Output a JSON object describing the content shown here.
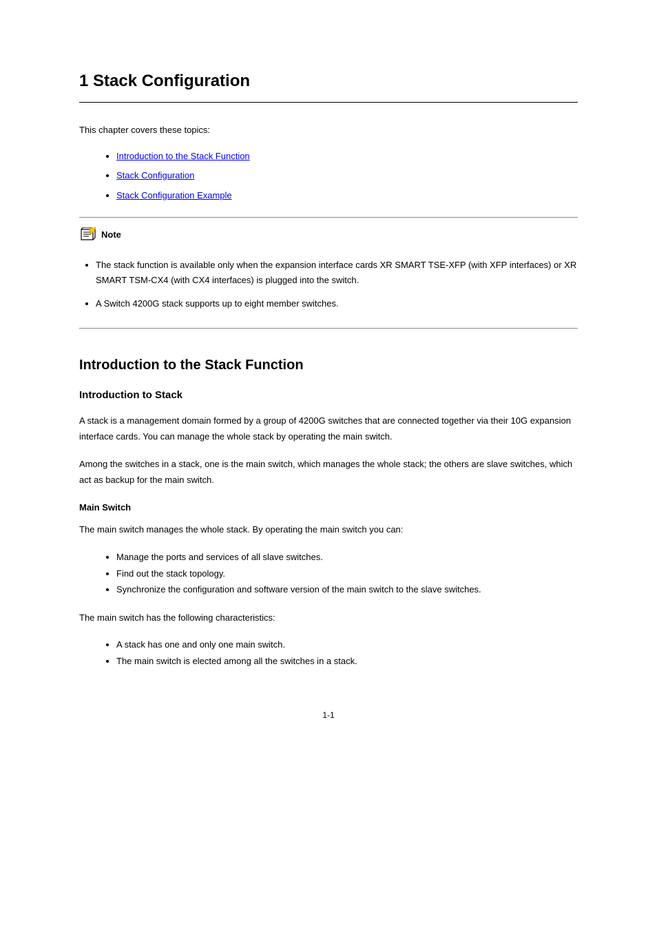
{
  "chapter_title": "1 Stack Configuration",
  "intro_text": "This chapter covers these topics:",
  "toc_links": [
    {
      "label": "Introduction to the Stack Function"
    },
    {
      "label": "Stack Configuration"
    },
    {
      "label": "Stack Configuration Example"
    }
  ],
  "note": {
    "label": "Note",
    "items": [
      "The stack function is available only when the expansion interface cards XR SMART TSE-XFP (with XFP interfaces) or XR SMART TSM-CX4 (with CX4 interfaces) is plugged into the switch.",
      "A Switch 4200G stack supports up to eight member switches."
    ]
  },
  "section1": {
    "title": "Introduction to the Stack Function",
    "sub1": {
      "title": "Introduction to Stack",
      "para1": "A stack is a management domain formed by a group of 4200G switches that are connected together via their 10G expansion interface cards. You can manage the whole stack by operating the main switch.",
      "para2": "Among the switches in a stack, one is the main switch, which manages the whole stack; the others are slave switches, which act as backup for the main switch."
    },
    "sub2": {
      "title": "Main Switch",
      "para1": "The main switch manages the whole stack. By operating the main switch you can:",
      "items": [
        "Manage the ports and services of all slave switches.",
        "Find out the stack topology.",
        "Synchronize the configuration and software version of the main switch to the slave switches."
      ],
      "para2": "The main switch has the following characteristics:",
      "items2": [
        "A stack has one and only one main switch.",
        "The main switch is elected among all the switches in a stack."
      ]
    }
  },
  "page_number": "1-1"
}
